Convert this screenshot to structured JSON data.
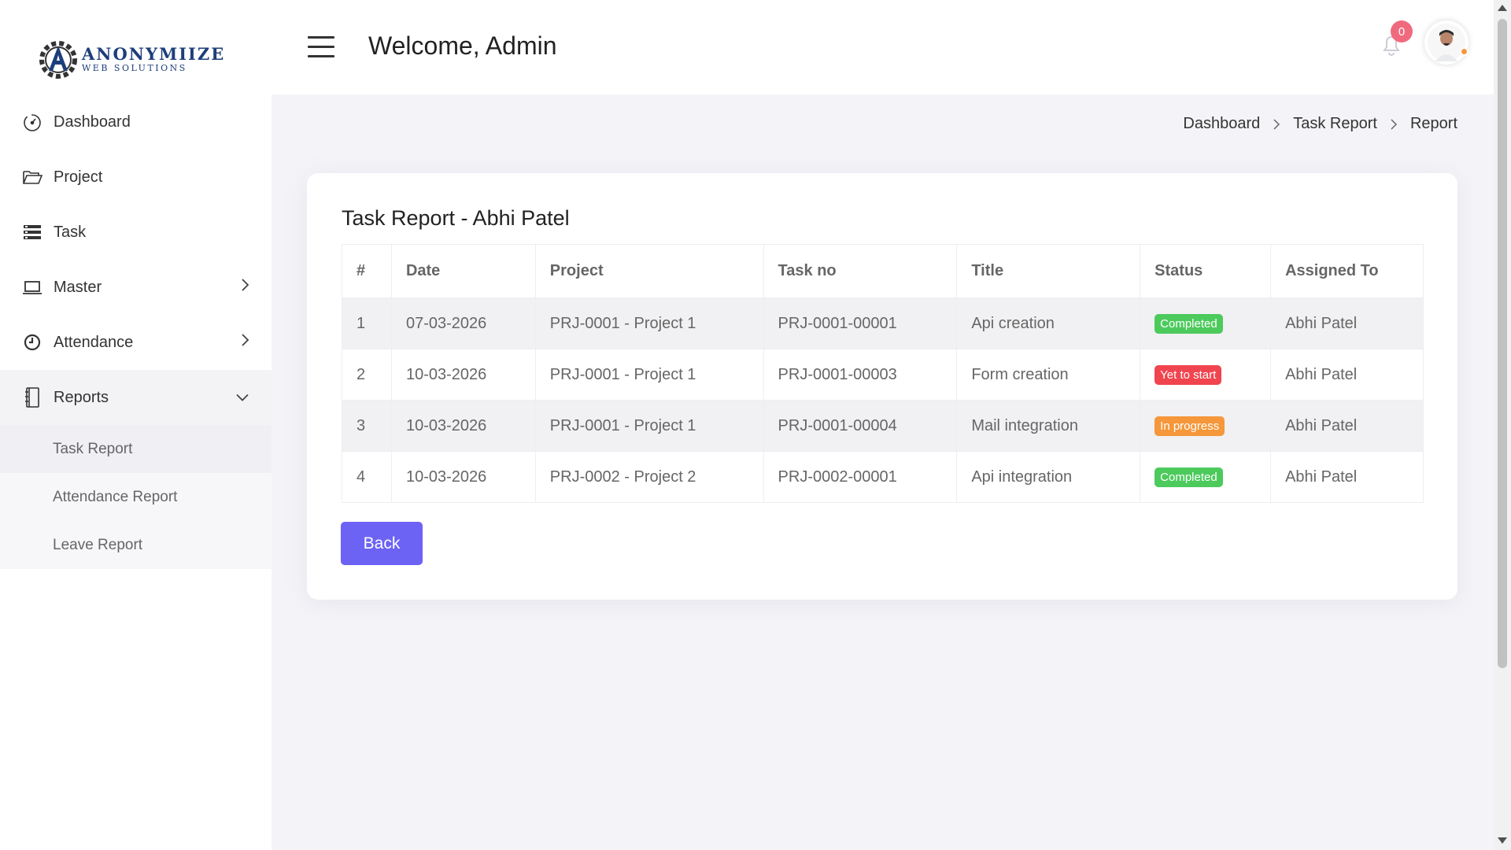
{
  "brand": {
    "name": "ANONYMIIZE",
    "tagline": "WEB SOLUTIONS",
    "colors": {
      "logo": "#1d3e7a",
      "logo_accent": "#3a3a3a"
    }
  },
  "sidebar": {
    "items": [
      {
        "label": "Dashboard",
        "icon": "dashboard-gauge-icon"
      },
      {
        "label": "Project",
        "icon": "folder-open-icon"
      },
      {
        "label": "Task",
        "icon": "task-list-icon"
      },
      {
        "label": "Master",
        "icon": "laptop-icon",
        "chevron": "chevron-right-icon"
      },
      {
        "label": "Attendance",
        "icon": "clock-icon",
        "chevron": "chevron-right-icon"
      },
      {
        "label": "Reports",
        "icon": "notebook-icon",
        "chevron": "chevron-down-icon",
        "expanded": true
      }
    ],
    "reports_subitems": [
      "Task Report",
      "Attendance Report",
      "Leave Report"
    ],
    "active_subitem": "Task Report"
  },
  "header": {
    "welcome": "Welcome, Admin",
    "notification_count": "0",
    "colors": {
      "badge": "#f06a7e",
      "status_dot": "#f5973a"
    }
  },
  "breadcrumb": [
    "Dashboard",
    "Task Report",
    "Report"
  ],
  "report": {
    "title": "Task Report - Abhi Patel",
    "columns": [
      "#",
      "Date",
      "Project",
      "Task no",
      "Title",
      "Status",
      "Assigned To"
    ],
    "rows": [
      {
        "num": "1",
        "date": "07-03-2026",
        "project": "PRJ-0001 - Project 1",
        "task_no": "PRJ-0001-00001",
        "title": "Api creation",
        "status": "Completed",
        "status_color": "#4cca5c",
        "assigned": "Abhi Patel"
      },
      {
        "num": "2",
        "date": "10-03-2026",
        "project": "PRJ-0001 - Project 1",
        "task_no": "PRJ-0001-00003",
        "title": "Form creation",
        "status": "Yet to start",
        "status_color": "#f0454f",
        "assigned": "Abhi Patel"
      },
      {
        "num": "3",
        "date": "10-03-2026",
        "project": "PRJ-0001 - Project 1",
        "task_no": "PRJ-0001-00004",
        "title": "Mail integration",
        "status": "In progress",
        "status_color": "#f5973a",
        "assigned": "Abhi Patel"
      },
      {
        "num": "4",
        "date": "10-03-2026",
        "project": "PRJ-0002 - Project 2",
        "task_no": "PRJ-0002-00001",
        "title": "Api integration",
        "status": "Completed",
        "status_color": "#4cca5c",
        "assigned": "Abhi Patel"
      }
    ],
    "back_label": "Back",
    "colors": {
      "primary": "#6c63f5",
      "stripe": "#f1f1f3"
    }
  }
}
